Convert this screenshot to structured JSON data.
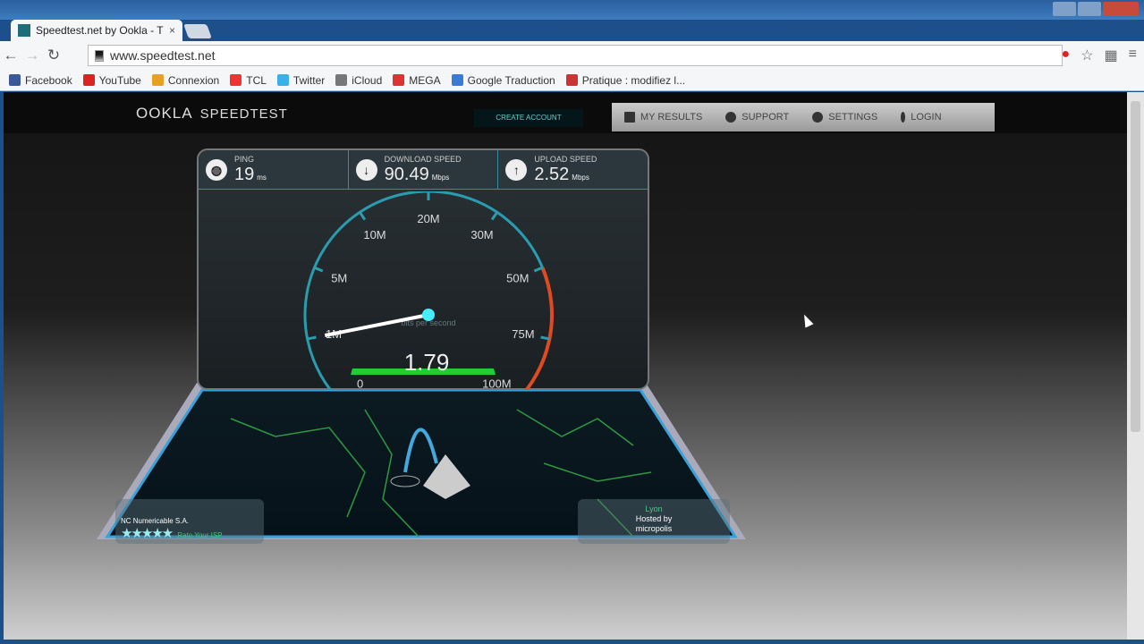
{
  "browser": {
    "tab_title": "Speedtest.net by Ookla - T",
    "url": "www.speedtest.net",
    "bookmarks": [
      {
        "label": "Facebook",
        "color": "#3b5998"
      },
      {
        "label": "YouTube",
        "color": "#d22"
      },
      {
        "label": "Connexion",
        "color": "#e8a020"
      },
      {
        "label": "TCL",
        "color": "#e33"
      },
      {
        "label": "Twitter",
        "color": "#3ab0e8"
      },
      {
        "label": "iCloud",
        "color": "#777"
      },
      {
        "label": "MEGA",
        "color": "#d33"
      },
      {
        "label": "Google Traduction",
        "color": "#3a7bd5"
      },
      {
        "label": "Pratique : modifiez l...",
        "color": "#c33"
      }
    ]
  },
  "site": {
    "logo": "OOKLA",
    "logo_sub": "SPEEDTEST",
    "create_account": "CREATE ACCOUNT",
    "menu": [
      "MY RESULTS",
      "SUPPORT",
      "SETTINGS",
      "LOGIN"
    ]
  },
  "stats": {
    "ping": {
      "label": "PING",
      "value": "19",
      "unit": "ms"
    },
    "download": {
      "label": "DOWNLOAD SPEED",
      "value": "90.49",
      "unit": "Mbps"
    },
    "upload": {
      "label": "UPLOAD SPEED",
      "value": "2.52",
      "unit": "Mbps"
    }
  },
  "gauge": {
    "ticks": [
      "0",
      "1M",
      "5M",
      "10M",
      "20M",
      "30M",
      "50M",
      "75M",
      "100M"
    ],
    "unit_label": "bits per second",
    "current": "1.79",
    "needle_tick_position": 1.0
  },
  "isp": {
    "name": "NC Numericable S.A.",
    "stars": "★★★★★",
    "rate": "Rate Your ISP"
  },
  "server": {
    "city": "Lyon",
    "hosted_by": "Hosted by",
    "host": "micropolis"
  }
}
